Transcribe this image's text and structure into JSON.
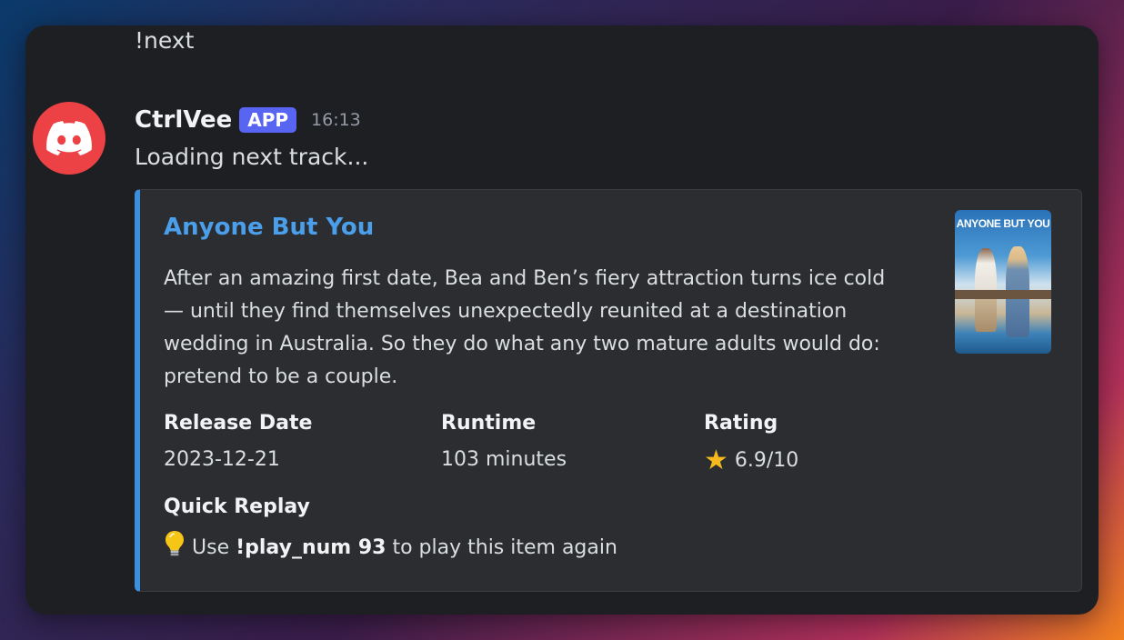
{
  "previous_message": "!next",
  "message": {
    "author": "CtrlVee",
    "badge": "APP",
    "timestamp": "16:13",
    "content": "Loading next track..."
  },
  "embed": {
    "accent_color": "#3b8fdc",
    "title": "Anyone But You",
    "description": "After an amazing first date, Bea and Ben’s fiery attraction turns ice cold — until they find themselves unexpectedly reunited at a destination wedding in Australia. So they do what any two mature adults would do: pretend to be a couple.",
    "thumbnail_text": "ANYONE BUT YOU",
    "fields": [
      {
        "name": "Release Date",
        "value": "2023-12-21"
      },
      {
        "name": "Runtime",
        "value": "103 minutes"
      },
      {
        "name": "Rating",
        "icon": "star-icon",
        "value": "6.9/10"
      }
    ],
    "quick_replay": {
      "name": "Quick Replay",
      "icon": "lightbulb-icon",
      "prefix": "Use",
      "command": "!play_num 93",
      "suffix": "to play this item again"
    }
  },
  "colors": {
    "avatar_bg": "#ed4245",
    "badge_bg": "#5865f2",
    "link": "#4b9eea"
  }
}
